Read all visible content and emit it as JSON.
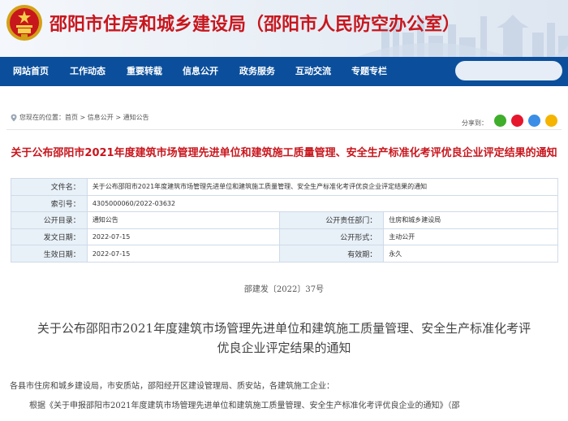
{
  "header": {
    "title": "邵阳市住房和城乡建设局（邵阳市人民防空办公室）"
  },
  "nav": {
    "items": [
      "网站首页",
      "工作动态",
      "重要转载",
      "信息公开",
      "政务服务",
      "互动交流",
      "专题专栏"
    ]
  },
  "breadcrumb": {
    "prefix": "您现在的位置：",
    "items": [
      "首页",
      "信息公开",
      "通知公告"
    ],
    "separator": " > "
  },
  "share": {
    "label": "分享到：",
    "icons": [
      "wechat-icon",
      "weibo-icon",
      "qq-icon",
      "qzone-icon"
    ],
    "colors": [
      "#3fae2a",
      "#e6162d",
      "#3a8ee6",
      "#f4b400"
    ]
  },
  "doc_title": "关于公布邵阳市2021年度建筑市场管理先进单位和建筑施工质量管理、安全生产标准化考评优良企业评定结果的通知",
  "info": {
    "file_name_label": "文件名：",
    "file_name_value": "关于公布邵阳市2021年度建筑市场管理先进单位和建筑施工质量管理、安全生产标准化考评优良企业评定结果的通知",
    "index_label": "索引号：",
    "index_value": "4305000060/2022-03632",
    "catalog_label": "公开目录：",
    "catalog_value": "通知公告",
    "dept_label": "公开责任部门：",
    "dept_value": "住房和城乡建设局",
    "publish_label": "发文日期：",
    "publish_value": "2022-07-15",
    "form_label": "公开形式：",
    "form_value": "主动公开",
    "effective_label": "生效日期：",
    "effective_value": "2022-07-15",
    "validity_label": "有效期：",
    "validity_value": "永久"
  },
  "doc_number": "邵建发〔2022〕37号",
  "body": {
    "title_line1": "关于公布邵阳市2021年度建筑市场管理先进单位和建筑施工质量管理、安全生产标准化考评",
    "title_line2": "优良企业评定结果的通知",
    "recipients": "各县市住房和城乡建设局，市安质站，邵阳经开区建设管理局、质安站，各建筑施工企业：",
    "para1": "根据《关于申报邵阳市2021年度建筑市场管理先进单位和建筑施工质量管理、安全生产标准化考评优良企业的通知》（邵"
  },
  "colors": {
    "brand_red": "#c8161d",
    "nav_blue": "#0b4f9c",
    "label_bg": "#e8f0f8"
  }
}
